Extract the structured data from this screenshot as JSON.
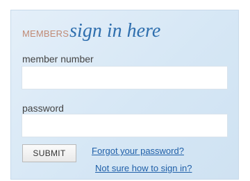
{
  "login": {
    "heading_prefix": "MEMBERS",
    "heading_main": "sign in here",
    "member_number_label": "member number",
    "member_number_value": "",
    "password_label": "password",
    "password_value": "",
    "submit_label": "SUBMIT",
    "forgot_link": "Forgot your password?",
    "help_link": "Not sure how to sign in?"
  },
  "colors": {
    "panel_background": "#d6e7f5",
    "heading_prefix": "#c08a75",
    "heading_main": "#2f6fae",
    "link": "#1f5fa8"
  }
}
